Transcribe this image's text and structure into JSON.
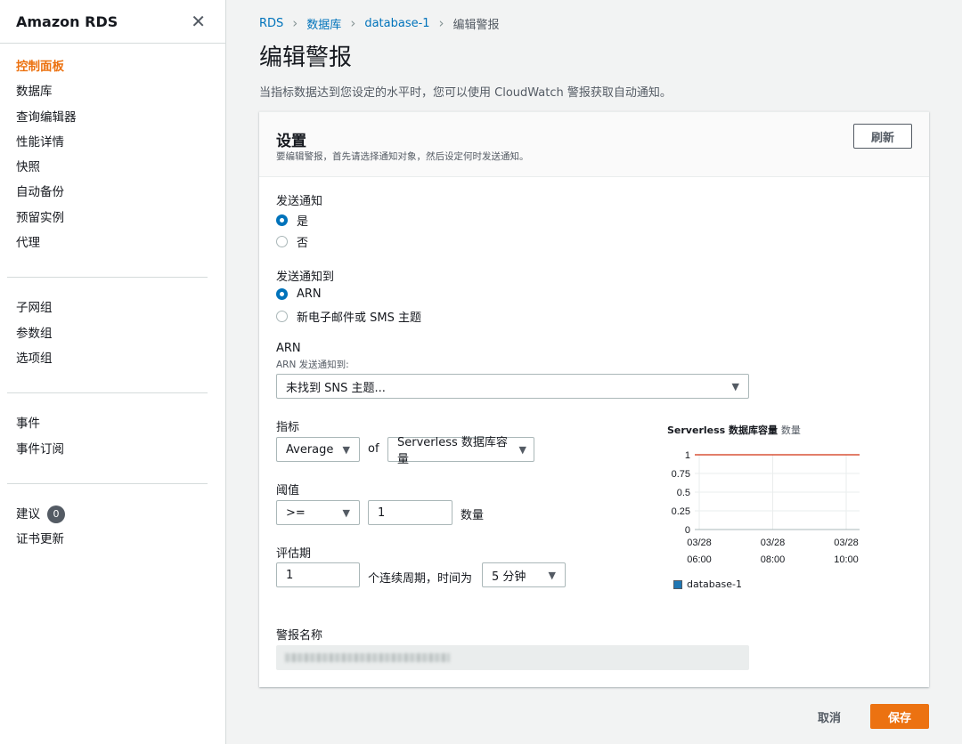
{
  "sidebar": {
    "title": "Amazon RDS",
    "close_icon": "close-icon",
    "group1": [
      "控制面板",
      "数据库",
      "查询编辑器",
      "性能详情",
      "快照",
      "自动备份",
      "预留实例",
      "代理"
    ],
    "group2": [
      "子网组",
      "参数组",
      "选项组"
    ],
    "group3": [
      "事件",
      "事件订阅"
    ],
    "group4_suggest": "建议",
    "group4_suggest_count": "0",
    "group4_cert": "证书更新"
  },
  "breadcrumb": [
    "RDS",
    "数据库",
    "database-1",
    "编辑警报"
  ],
  "page": {
    "title": "编辑警报",
    "description": "当指标数据达到您设定的水平时，您可以使用 CloudWatch 警报获取自动通知。"
  },
  "panel": {
    "title": "设置",
    "subtitle": "要编辑警报，首先请选择通知对象，然后设定何时发送通知。",
    "refresh_label": "刷新",
    "send_notification": {
      "label": "发送通知",
      "options": [
        "是",
        "否"
      ],
      "selected": "是"
    },
    "send_to": {
      "label": "发送通知到",
      "options": [
        "ARN",
        "新电子邮件或 SMS 主题"
      ],
      "selected": "ARN"
    },
    "arn": {
      "label": "ARN",
      "sublabel": "ARN 发送通知到:",
      "value": "未找到 SNS 主题..."
    },
    "metric": {
      "label": "指标",
      "stat": "Average",
      "of": "of",
      "metric_name": "Serverless 数据库容量"
    },
    "threshold": {
      "label": "阈值",
      "operator": ">=",
      "value": "1",
      "unit": "数量"
    },
    "period": {
      "label": "评估期",
      "value": "1",
      "text": "个连续周期，时间为",
      "duration": "5 分钟"
    },
    "alarm_name": {
      "label": "警报名称"
    }
  },
  "chart_data": {
    "type": "line",
    "title": "Serverless 数据库容量",
    "unit": "数量",
    "yticks": [
      "1",
      "0.75",
      "0.5",
      "0.25",
      "0"
    ],
    "ylim": [
      0,
      1
    ],
    "xticks": [
      [
        "03/28",
        "06:00"
      ],
      [
        "03/28",
        "08:00"
      ],
      [
        "03/28",
        "10:00"
      ]
    ],
    "threshold": 1,
    "threshold_color": "#d13212",
    "series": [
      {
        "name": "database-1",
        "color": "#1f77b4",
        "values": []
      }
    ],
    "grid": true,
    "legend": "bottom-left"
  },
  "footer": {
    "cancel": "取消",
    "save": "保存"
  },
  "colors": {
    "accent": "#ec7211",
    "link": "#0073bb"
  }
}
